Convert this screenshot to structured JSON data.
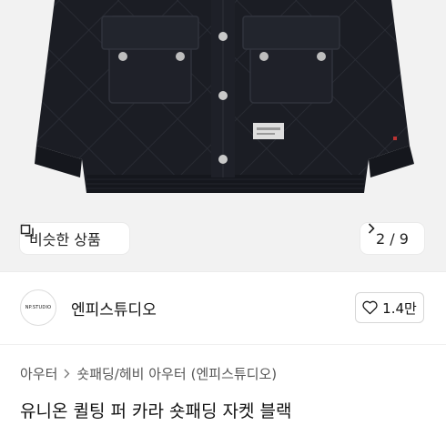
{
  "gallery": {
    "similar_label": "비슷한 상품",
    "page_indicator": "2 / 9"
  },
  "shop": {
    "logo_text": "NP.STUDIO",
    "name": "엔피스튜디오",
    "likes": "1.4만"
  },
  "breadcrumb": [
    "아우터",
    "숏패딩/헤비 아우터",
    "(엔피스튜디오)"
  ],
  "product": {
    "title": "유니온 퀼팅 퍼 카라 숏패딩 자켓 블랙"
  },
  "colors": {
    "hero_bg": "#f2f2f2",
    "jacket": "#1b1d24"
  }
}
